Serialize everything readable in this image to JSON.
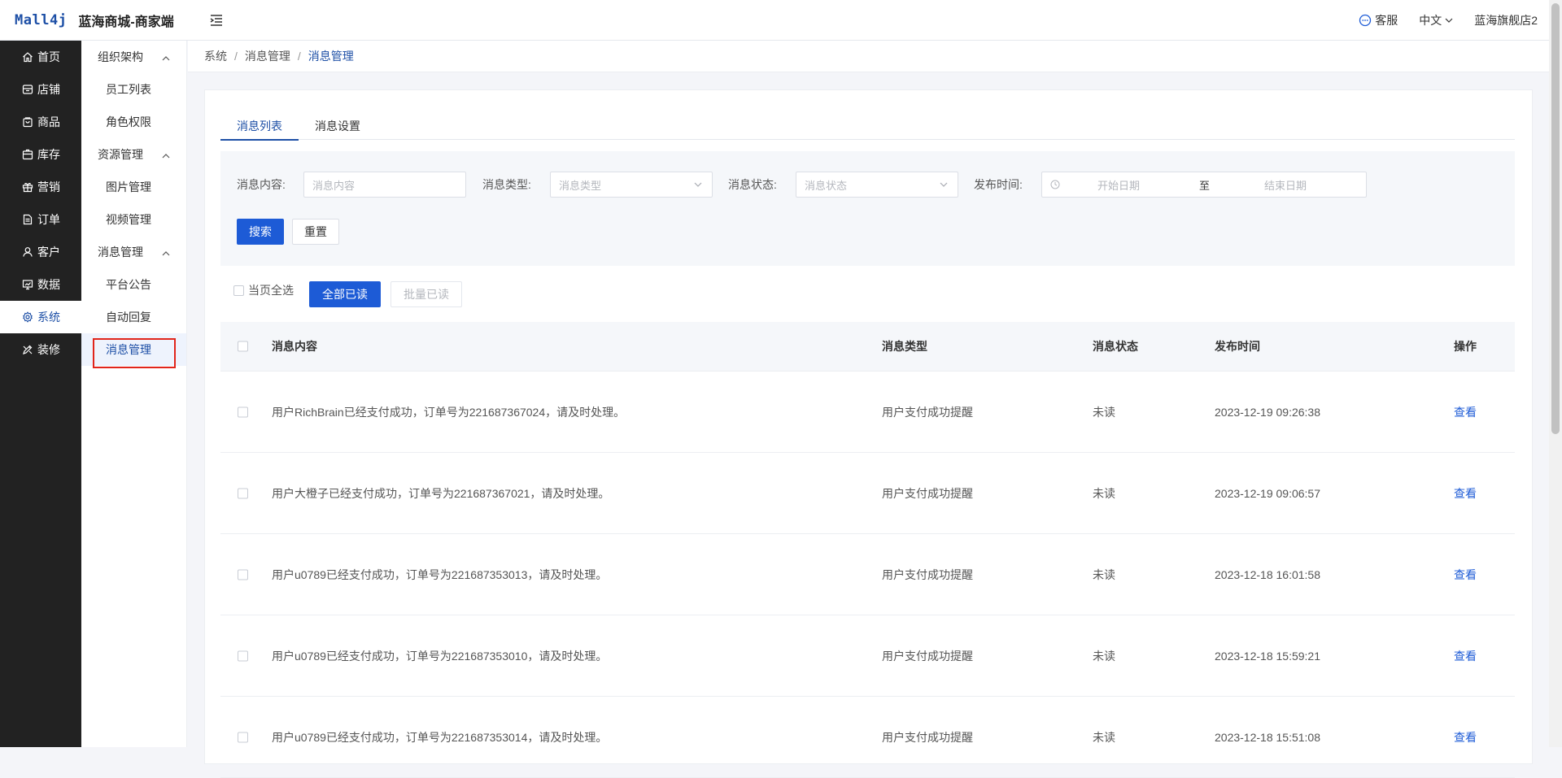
{
  "header": {
    "logo_text": "Mall4j",
    "app_title": "蓝海商城-商家端",
    "support_label": "客服",
    "language": "中文",
    "store_name": "蓝海旗舰店2"
  },
  "primary_nav": [
    {
      "label": "首页",
      "icon": "home-icon",
      "active": false
    },
    {
      "label": "店铺",
      "icon": "store-icon",
      "active": false
    },
    {
      "label": "商品",
      "icon": "bag-icon",
      "active": false
    },
    {
      "label": "库存",
      "icon": "inventory-icon",
      "active": false
    },
    {
      "label": "营销",
      "icon": "gift-icon",
      "active": false
    },
    {
      "label": "订单",
      "icon": "order-icon",
      "active": false
    },
    {
      "label": "客户",
      "icon": "user-icon",
      "active": false
    },
    {
      "label": "数据",
      "icon": "data-icon",
      "active": false
    },
    {
      "label": "系统",
      "icon": "gear-icon",
      "active": true
    },
    {
      "label": "装修",
      "icon": "decorate-icon",
      "active": false
    }
  ],
  "secondary_nav": {
    "groups": [
      {
        "title": "组织架构",
        "items": [
          "员工列表",
          "角色权限"
        ]
      },
      {
        "title": "资源管理",
        "items": [
          "图片管理",
          "视频管理"
        ]
      },
      {
        "title": "消息管理",
        "items": [
          "平台公告",
          "自动回复",
          "消息管理"
        ]
      }
    ],
    "active_item": "消息管理"
  },
  "breadcrumb": [
    "系统",
    "消息管理",
    "消息管理"
  ],
  "tabs": [
    {
      "label": "消息列表",
      "active": true
    },
    {
      "label": "消息设置",
      "active": false
    }
  ],
  "filters": {
    "content_label": "消息内容:",
    "content_placeholder": "消息内容",
    "type_label": "消息类型:",
    "type_placeholder": "消息类型",
    "status_label": "消息状态:",
    "status_placeholder": "消息状态",
    "time_label": "发布时间:",
    "start_placeholder": "开始日期",
    "range_sep": "至",
    "end_placeholder": "结束日期",
    "search_label": "搜索",
    "reset_label": "重置"
  },
  "bulk_actions": {
    "select_page_label": "当页全选",
    "mark_all_read_label": "全部已读",
    "batch_read_label": "批量已读"
  },
  "table": {
    "columns": [
      "消息内容",
      "消息类型",
      "消息状态",
      "发布时间",
      "操作"
    ],
    "rows": [
      {
        "content": "用户RichBrain已经支付成功，订单号为221687367024，请及时处理。",
        "type": "用户支付成功提醒",
        "status": "未读",
        "time": "2023-12-19 09:26:38",
        "action": "查看"
      },
      {
        "content": "用户大橙子已经支付成功，订单号为221687367021，请及时处理。",
        "type": "用户支付成功提醒",
        "status": "未读",
        "time": "2023-12-19 09:06:57",
        "action": "查看"
      },
      {
        "content": "用户u0789已经支付成功，订单号为221687353013，请及时处理。",
        "type": "用户支付成功提醒",
        "status": "未读",
        "time": "2023-12-18 16:01:58",
        "action": "查看"
      },
      {
        "content": "用户u0789已经支付成功，订单号为221687353010，请及时处理。",
        "type": "用户支付成功提醒",
        "status": "未读",
        "time": "2023-12-18 15:59:21",
        "action": "查看"
      },
      {
        "content": "用户u0789已经支付成功，订单号为221687353014，请及时处理。",
        "type": "用户支付成功提醒",
        "status": "未读",
        "time": "2023-12-18 15:51:08",
        "action": "查看"
      }
    ]
  },
  "colors": {
    "primary": "#1d5bd6",
    "sidebar_bg": "#222222",
    "highlight_box": "#e1251b"
  }
}
